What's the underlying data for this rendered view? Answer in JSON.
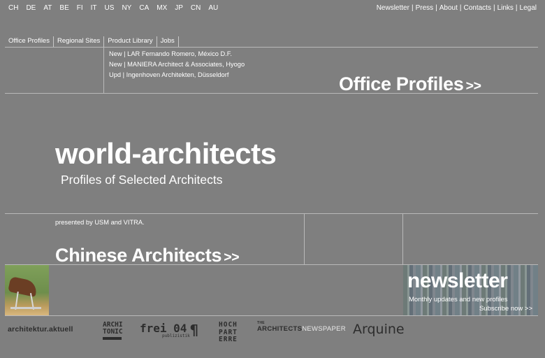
{
  "countries": [
    "CH",
    "DE",
    "AT",
    "BE",
    "FI",
    "IT",
    "US",
    "NY",
    "CA",
    "MX",
    "JP",
    "CN",
    "AU"
  ],
  "top_links": [
    "Newsletter",
    "Press",
    "About",
    "Contacts",
    "Links",
    "Legal"
  ],
  "top_link_separator": "|",
  "tabs": [
    "Office Profiles",
    "Regional Sites",
    "Product Library",
    "Jobs"
  ],
  "updates": [
    "New | LAR Fernando Romero, México D.F.",
    "New | MANIERA Architect & Associates, Hyogo",
    "Upd | Ingenhoven Architekten, Düsseldorf"
  ],
  "office_profiles": {
    "label": "Office Profiles",
    "arrow": ">>"
  },
  "brand": {
    "title": "world-architects",
    "subtitle": "Profiles of Selected Architects"
  },
  "presented_by": "presented by USM and VITRA.",
  "chinese_architects": {
    "label": "Chinese Architects",
    "arrow": ">>"
  },
  "newsletter_box": {
    "title": "newsletter",
    "subtitle": "Monthly updates and new profiles",
    "cta": "Subscribe now >>"
  },
  "partners": {
    "aktuell": "architektur.aktuell",
    "architonic_line1": "ARCHI",
    "architonic_line2": "TONIC",
    "frei": "frei 04",
    "frei_small": "publizistik",
    "frei_mark": "¶",
    "hochparterre_line1": "HOCH",
    "hochparterre_line2": "PART",
    "hochparterre_line3": "ERRE",
    "archnews_the": "THE",
    "archnews_main": "ARCHITECTS",
    "archnews_paper": "NEWSPAPER",
    "arquine": "Arquine"
  },
  "colors": {
    "background": "#7f7f7f",
    "text": "#ffffff",
    "lines": "#b9b9b9",
    "logos": "#2d2d2d"
  }
}
